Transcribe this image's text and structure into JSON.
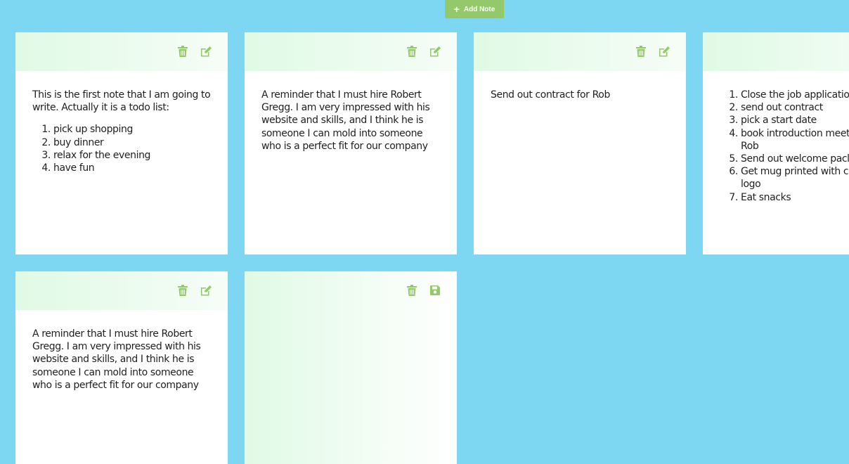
{
  "toolbar": {
    "add_label": "Add Note",
    "plus_glyph": "+"
  },
  "colors": {
    "background": "#7dd7f2",
    "accent": "#93c96a",
    "note_header": "#e0fae5"
  },
  "notes": [
    {
      "text": "This is the first note that I am going to write. Actually it is a todo list:",
      "items": [
        "pick up shopping",
        "buy dinner",
        "relax for the evening",
        "have fun"
      ],
      "actions": [
        "trash-icon",
        "edit-icon"
      ]
    },
    {
      "text": "A reminder that I must hire Robert Gregg. I am very impressed with his website and skills, and I think he is someone I can mold into someone who is a perfect fit for our company",
      "items": [],
      "actions": [
        "trash-icon",
        "edit-icon"
      ]
    },
    {
      "text": "Send out contract for Rob",
      "items": [],
      "actions": [
        "trash-icon",
        "edit-icon"
      ]
    },
    {
      "text": "",
      "items": [
        "Close the job applicatio",
        "send out contract",
        "pick a start date",
        "book introduction meet Rob",
        "Send out welcome pacl",
        "Get mug printed with co logo",
        "Eat snacks"
      ],
      "actions": [
        "trash-icon",
        "edit-icon"
      ]
    },
    {
      "text": "A reminder that I must hire Robert Gregg. I am very impressed with his website and skills, and I think he is someone I can mold into someone who is a perfect fit for our company",
      "items": [],
      "actions": [
        "trash-icon",
        "edit-icon"
      ]
    },
    {
      "text": "",
      "items": [],
      "actions": [
        "trash-icon",
        "save-icon"
      ]
    }
  ]
}
